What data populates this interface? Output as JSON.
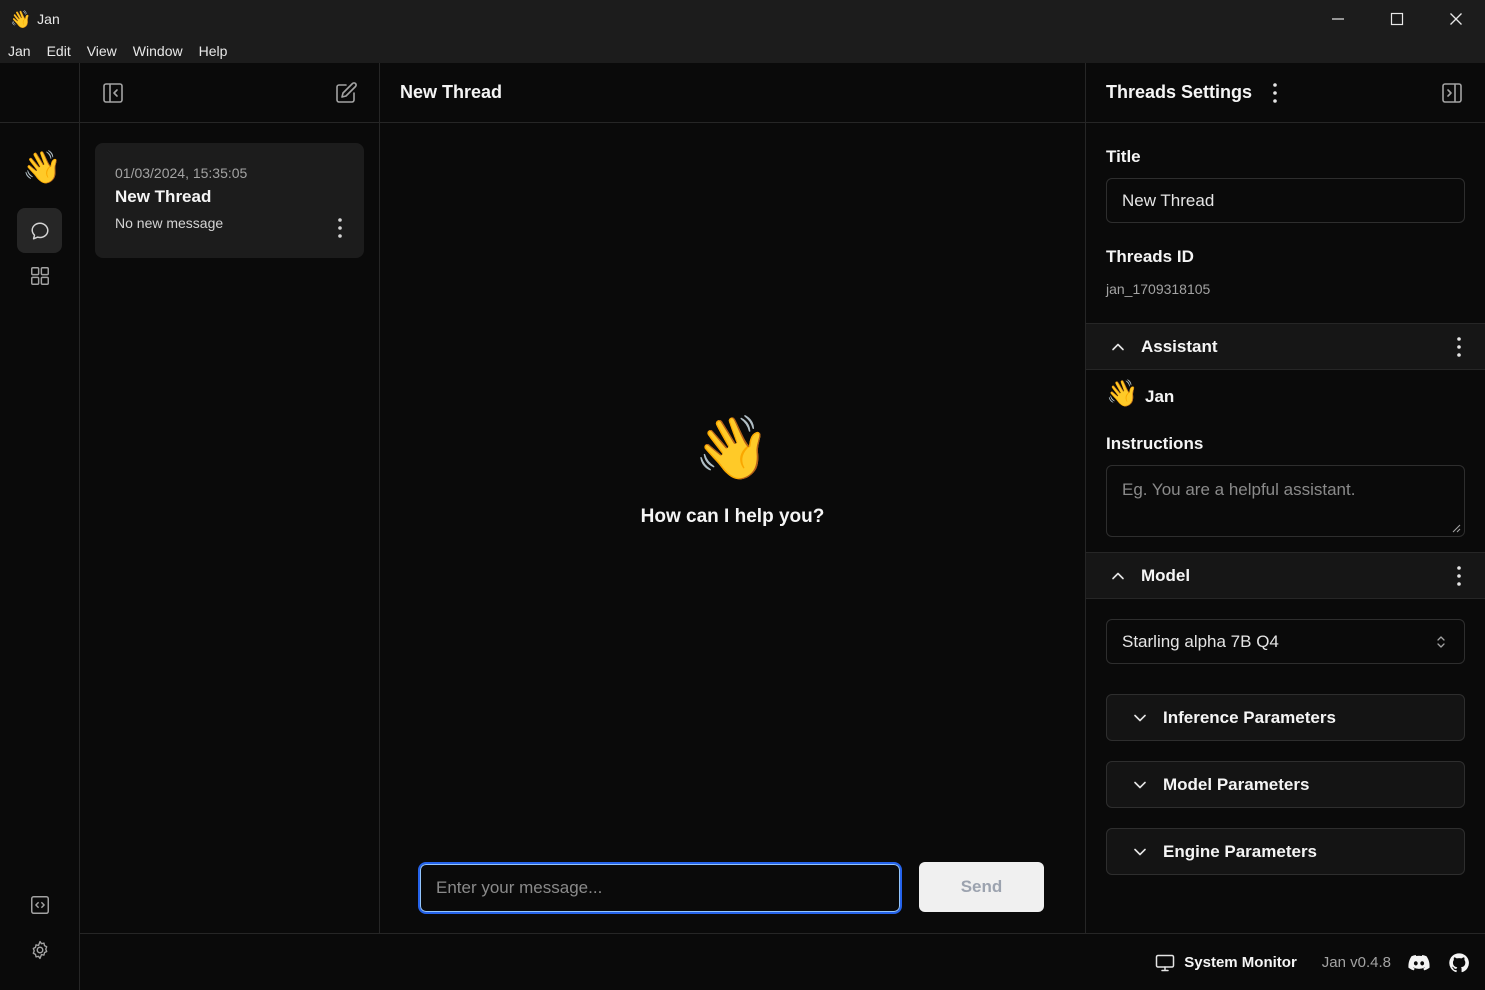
{
  "window": {
    "title": "Jan",
    "app_emoji": "👋"
  },
  "menu": [
    "Jan",
    "Edit",
    "View",
    "Window",
    "Help"
  ],
  "sidebar": {
    "logo_emoji": "👋",
    "icons": [
      "chat-icon",
      "grid-icon",
      "code-icon",
      "gear-icon"
    ]
  },
  "threads": {
    "items": [
      {
        "date": "01/03/2024, 15:35:05",
        "title": "New Thread",
        "preview": "No new message"
      }
    ]
  },
  "main": {
    "title": "New Thread",
    "welcome_emoji": "👋",
    "welcome_text": "How can I help you?",
    "input_placeholder": "Enter your message...",
    "send_label": "Send"
  },
  "settings": {
    "header": "Threads Settings",
    "title_label": "Title",
    "title_value": "New Thread",
    "id_label": "Threads ID",
    "id_value": "jan_1709318105",
    "assistant_section": "Assistant",
    "assistant_emoji": "👋",
    "assistant_name": "Jan",
    "instructions_label": "Instructions",
    "instructions_placeholder": "Eg. You are a helpful assistant.",
    "model_section": "Model",
    "model_selected": "Starling alpha 7B Q4",
    "collapsibles": [
      "Inference Parameters",
      "Model Parameters",
      "Engine Parameters"
    ]
  },
  "status": {
    "system_monitor": "System Monitor",
    "version": "Jan v0.4.8"
  },
  "colors": {
    "accent": "#2563eb",
    "background": "#0a0a0a",
    "surface": "#1c1c1c"
  }
}
